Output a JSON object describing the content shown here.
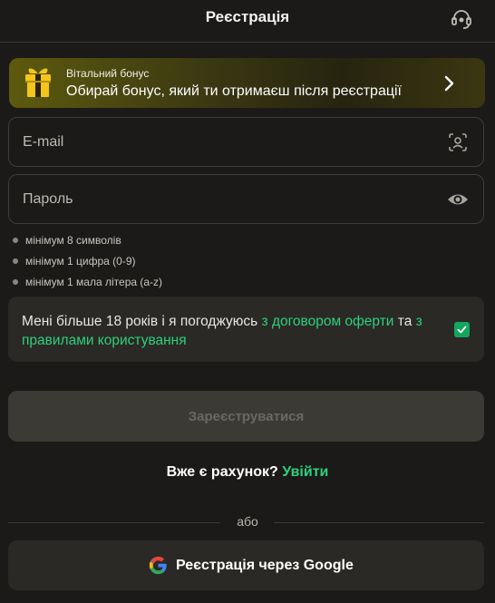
{
  "header": {
    "title": "Реєстрація",
    "support_icon": "headset-icon"
  },
  "bonus": {
    "caption": "Вітальний бонус",
    "text": "Обирай бонус, який ти отримаєш після реєстрації",
    "gift_icon": "gift-icon",
    "arrow_icon": "chevron-right-icon",
    "accent": "#5d5a0e"
  },
  "email": {
    "placeholder": "E-mail",
    "icon": "face-scan-icon"
  },
  "password": {
    "placeholder": "Пароль",
    "icon": "eye-icon"
  },
  "rules": [
    "мінімум 8 символів",
    "мінімум 1 цифра (0-9)",
    "мінімум 1 мала літера (a-z)"
  ],
  "agreement": {
    "prefix": "Мені більше 18 років і я погоджуюсь ",
    "offer_link": "з договором оферти",
    "middle": " та ",
    "rules_link": "з правилами користування",
    "checked": true,
    "link_color": "#2fd07c"
  },
  "register_button": "Зареєструватися",
  "login": {
    "question": "Вже є рахунок? ",
    "link": "Увійти"
  },
  "divider_text": "або",
  "google_button": "Реєстрація через Google"
}
